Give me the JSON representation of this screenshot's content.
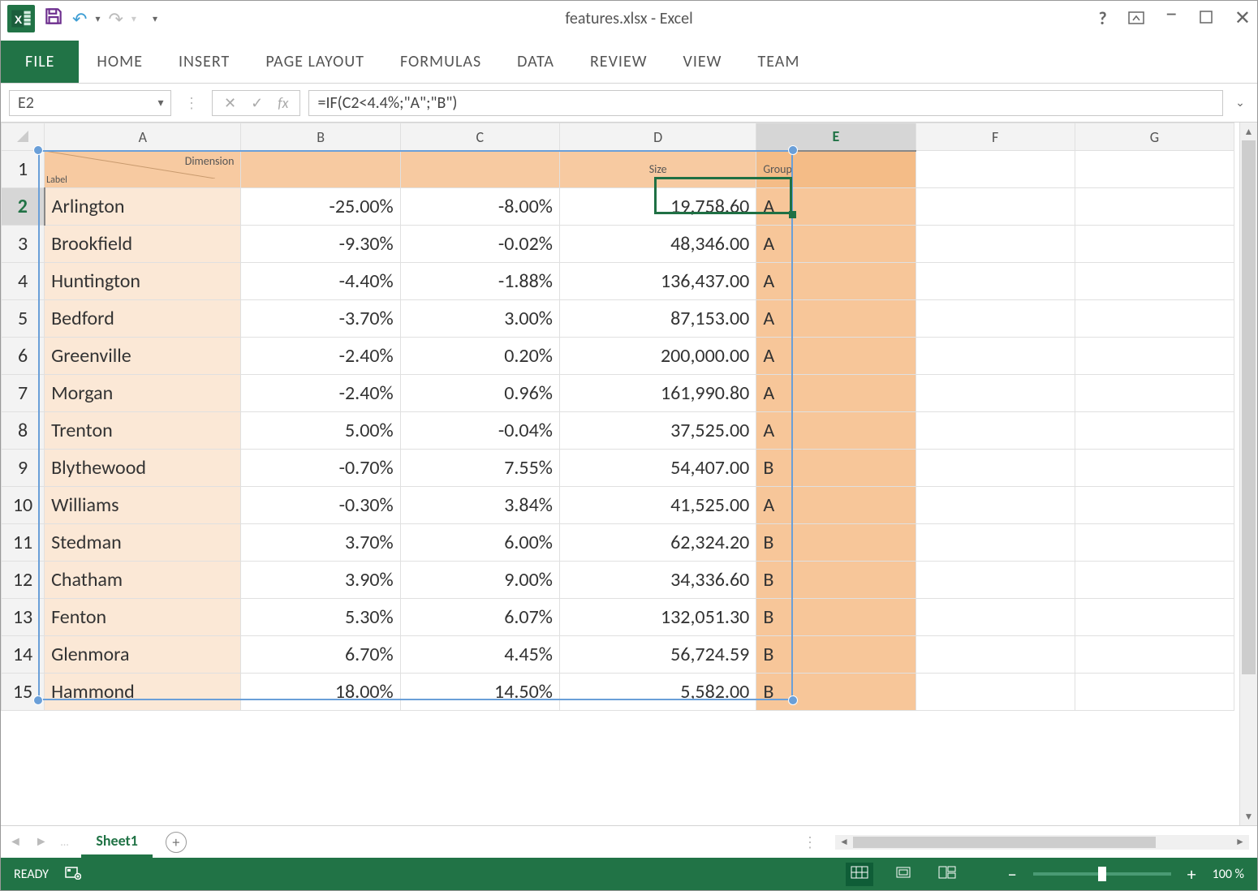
{
  "app_title": "features.xlsx - Excel",
  "ribbon_tabs": [
    "FILE",
    "HOME",
    "INSERT",
    "PAGE LAYOUT",
    "FORMULAS",
    "DATA",
    "REVIEW",
    "VIEW",
    "TEAM"
  ],
  "namebox": "E2",
  "formula": "=IF(C2<4.4%;\"A\";\"B\")",
  "column_letters": [
    "A",
    "B",
    "C",
    "D",
    "E",
    "F",
    "G"
  ],
  "header_row": {
    "label_left": "Label",
    "dimension": "Dimension",
    "size": "Size",
    "group": "Group"
  },
  "rows": [
    {
      "n": 2,
      "label": "Arlington",
      "b": "-25.00%",
      "c": "-8.00%",
      "d": "19,758.60",
      "e": "A"
    },
    {
      "n": 3,
      "label": "Brookfield",
      "b": "-9.30%",
      "c": "-0.02%",
      "d": "48,346.00",
      "e": "A"
    },
    {
      "n": 4,
      "label": "Huntington",
      "b": "-4.40%",
      "c": "-1.88%",
      "d": "136,437.00",
      "e": "A"
    },
    {
      "n": 5,
      "label": "Bedford",
      "b": "-3.70%",
      "c": "3.00%",
      "d": "87,153.00",
      "e": "A"
    },
    {
      "n": 6,
      "label": "Greenville",
      "b": "-2.40%",
      "c": "0.20%",
      "d": "200,000.00",
      "e": "A"
    },
    {
      "n": 7,
      "label": "Morgan",
      "b": "-2.40%",
      "c": "0.96%",
      "d": "161,990.80",
      "e": "A"
    },
    {
      "n": 8,
      "label": "Trenton",
      "b": "5.00%",
      "c": "-0.04%",
      "d": "37,525.00",
      "e": "A"
    },
    {
      "n": 9,
      "label": "Blythewood",
      "b": "-0.70%",
      "c": "7.55%",
      "d": "54,407.00",
      "e": "B"
    },
    {
      "n": 10,
      "label": "Williams",
      "b": "-0.30%",
      "c": "3.84%",
      "d": "41,525.00",
      "e": "A"
    },
    {
      "n": 11,
      "label": "Stedman",
      "b": "3.70%",
      "c": "6.00%",
      "d": "62,324.20",
      "e": "B"
    },
    {
      "n": 12,
      "label": "Chatham",
      "b": "3.90%",
      "c": "9.00%",
      "d": "34,336.60",
      "e": "B"
    },
    {
      "n": 13,
      "label": "Fenton",
      "b": "5.30%",
      "c": "6.07%",
      "d": "132,051.30",
      "e": "B"
    },
    {
      "n": 14,
      "label": "Glenmora",
      "b": "6.70%",
      "c": "4.45%",
      "d": "56,724.59",
      "e": "B"
    },
    {
      "n": 15,
      "label": "Hammond",
      "b": "18.00%",
      "c": "14.50%",
      "d": "5,582.00",
      "e": "B"
    }
  ],
  "sheet_tab": "Sheet1",
  "status_text": "READY",
  "zoom": "100 %"
}
